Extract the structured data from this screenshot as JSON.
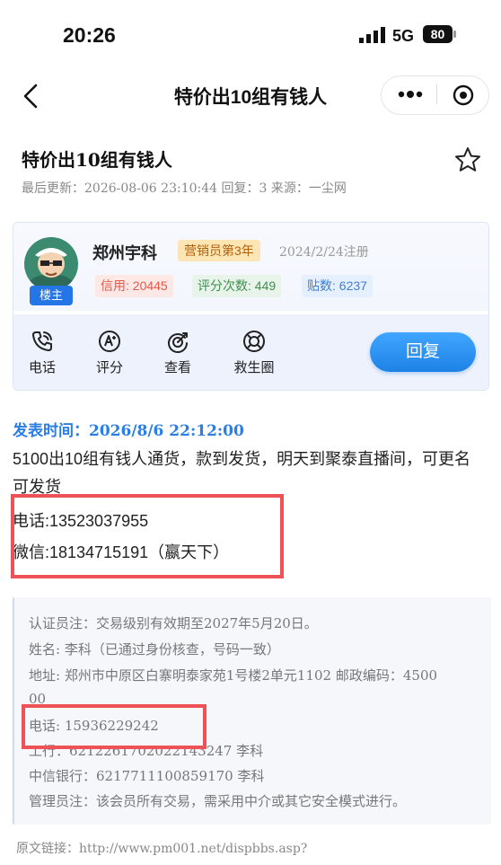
{
  "status_bar": {
    "time": "20:26",
    "network": "5G",
    "battery": "80"
  },
  "nav": {
    "title": "特价出10组有钱人"
  },
  "thread": {
    "title": "特价出10组有钱人",
    "meta": "最后更新：2026-08-06 23:10:44   回复：3   来源：一尘网"
  },
  "author": {
    "name": "郑州宇科",
    "role": "营销员第3年",
    "registered": "2024/2/24注册",
    "owner_badge": "楼主",
    "credit": "信用: 20445",
    "rating_count": "评分次数: 449",
    "posts": "贴数: 6237"
  },
  "actions": [
    {
      "label": "电话",
      "icon": "phone-icon"
    },
    {
      "label": "评分",
      "icon": "rate-icon"
    },
    {
      "label": "查看",
      "icon": "view-icon"
    },
    {
      "label": "救生圈",
      "icon": "lifebuoy-icon"
    }
  ],
  "reply_button": "回复",
  "post": {
    "time": "发表时间：2026/8/6 22:12:00",
    "body": "5100出10组有钱人通货，款到发货，明天到聚泰直播间，可更名可发货",
    "phone": "电话:13523037955",
    "wechat": "微信:18134715191（嬴天下）"
  },
  "verification": {
    "lines": [
      "认证员注：交易级别有效期至2027年5月20日。",
      "姓名: 李科（已通过身份核查，号码一致）",
      "地址: 郑州市中原区白寨明泰家苑1号楼2单元1102   邮政编码：4500",
      "00",
      "电话: 15936229242",
      "工行：6212261702022143247  李科",
      "中信银行：6217711100859170  李科",
      "管理员注：该会员所有交易，需采用中介或其它安全模式进行。"
    ]
  },
  "source_link": "原文链接：http://www.pm001.net/dispbbs.asp?",
  "colors": {
    "accent": "#2a7ee5",
    "highlight": "#ee5257",
    "role_badge": "#fde6b4"
  }
}
